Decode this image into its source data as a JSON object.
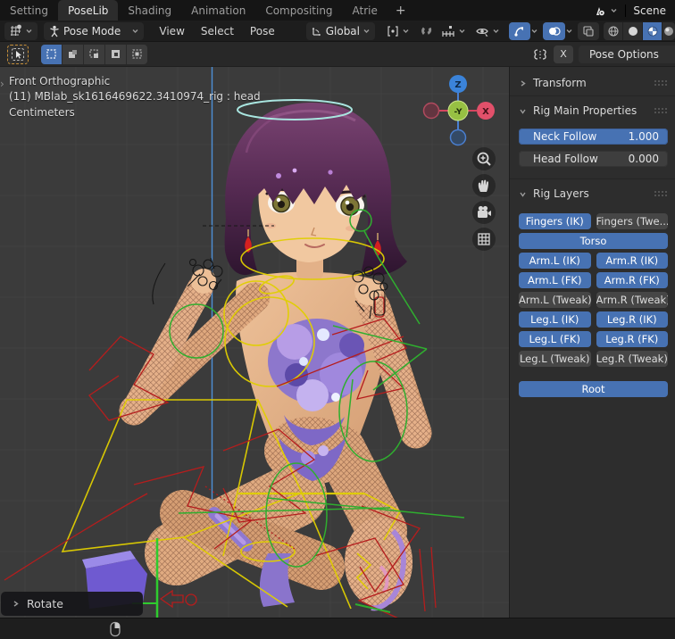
{
  "topbar": {
    "tabs": [
      {
        "label": "Setting",
        "active": false
      },
      {
        "label": "PoseLib",
        "active": true
      },
      {
        "label": "Shading",
        "active": false
      },
      {
        "label": "Animation",
        "active": false
      },
      {
        "label": "Compositing",
        "active": false
      },
      {
        "label": "Atrie",
        "active": false
      }
    ],
    "new_tab_label": "+",
    "scene_label": "Scene"
  },
  "header": {
    "mode_label": "Pose Mode",
    "menus": [
      "View",
      "Select",
      "Pose"
    ],
    "orientation_label": "Global"
  },
  "tool_settings": {
    "mirror_axis_label": "X",
    "pose_options_label": "Pose Options"
  },
  "viewport": {
    "view_name": "Front Orthographic",
    "active_object": "(11) MBlab_sk1616469622.3410974_rig : head",
    "units": "Centimeters",
    "operator_label": "Rotate",
    "gizmo": {
      "z": "Z",
      "neg_y": "-Y",
      "x": "X"
    }
  },
  "sidebar": {
    "transform_title": "Transform",
    "rig_main": {
      "title": "Rig Main Properties",
      "sliders": [
        {
          "label": "Neck Follow",
          "value": "1.000",
          "filled": true
        },
        {
          "label": "Head Follow",
          "value": "0.000",
          "filled": false
        }
      ]
    },
    "rig_layers": {
      "title": "Rig Layers",
      "buttons": [
        {
          "label": "Fingers (IK)",
          "active": true,
          "full": false
        },
        {
          "label": "Fingers (Twe...",
          "active": false,
          "full": false
        },
        {
          "label": "Torso",
          "active": true,
          "full": true
        },
        {
          "label": "Arm.L (IK)",
          "active": true,
          "full": false
        },
        {
          "label": "Arm.R (IK)",
          "active": true,
          "full": false
        },
        {
          "label": "Arm.L (FK)",
          "active": true,
          "full": false
        },
        {
          "label": "Arm.R (FK)",
          "active": true,
          "full": false
        },
        {
          "label": "Arm.L (Tweak)",
          "active": false,
          "full": false
        },
        {
          "label": "Arm.R (Tweak)",
          "active": false,
          "full": false
        },
        {
          "label": "Leg.L (IK)",
          "active": true,
          "full": false
        },
        {
          "label": "Leg.R (IK)",
          "active": true,
          "full": false
        },
        {
          "label": "Leg.L (FK)",
          "active": true,
          "full": false
        },
        {
          "label": "Leg.R (FK)",
          "active": true,
          "full": false
        },
        {
          "label": "Leg.L (Tweak)",
          "active": false,
          "full": false
        },
        {
          "label": "Leg.R (Tweak)",
          "active": false,
          "full": false
        }
      ],
      "root_label": "Root"
    }
  },
  "colors": {
    "accent_blue": "#4772b3",
    "axis_x_red": "#e2506a",
    "axis_z_blue": "#3b83d9",
    "axis_neg_y_green": "#97c043",
    "rig_yellow": "#e0cf00",
    "rig_red": "#b51d1d",
    "rig_green": "#2fae2f",
    "halo_cyan": "#a9e6e0"
  }
}
